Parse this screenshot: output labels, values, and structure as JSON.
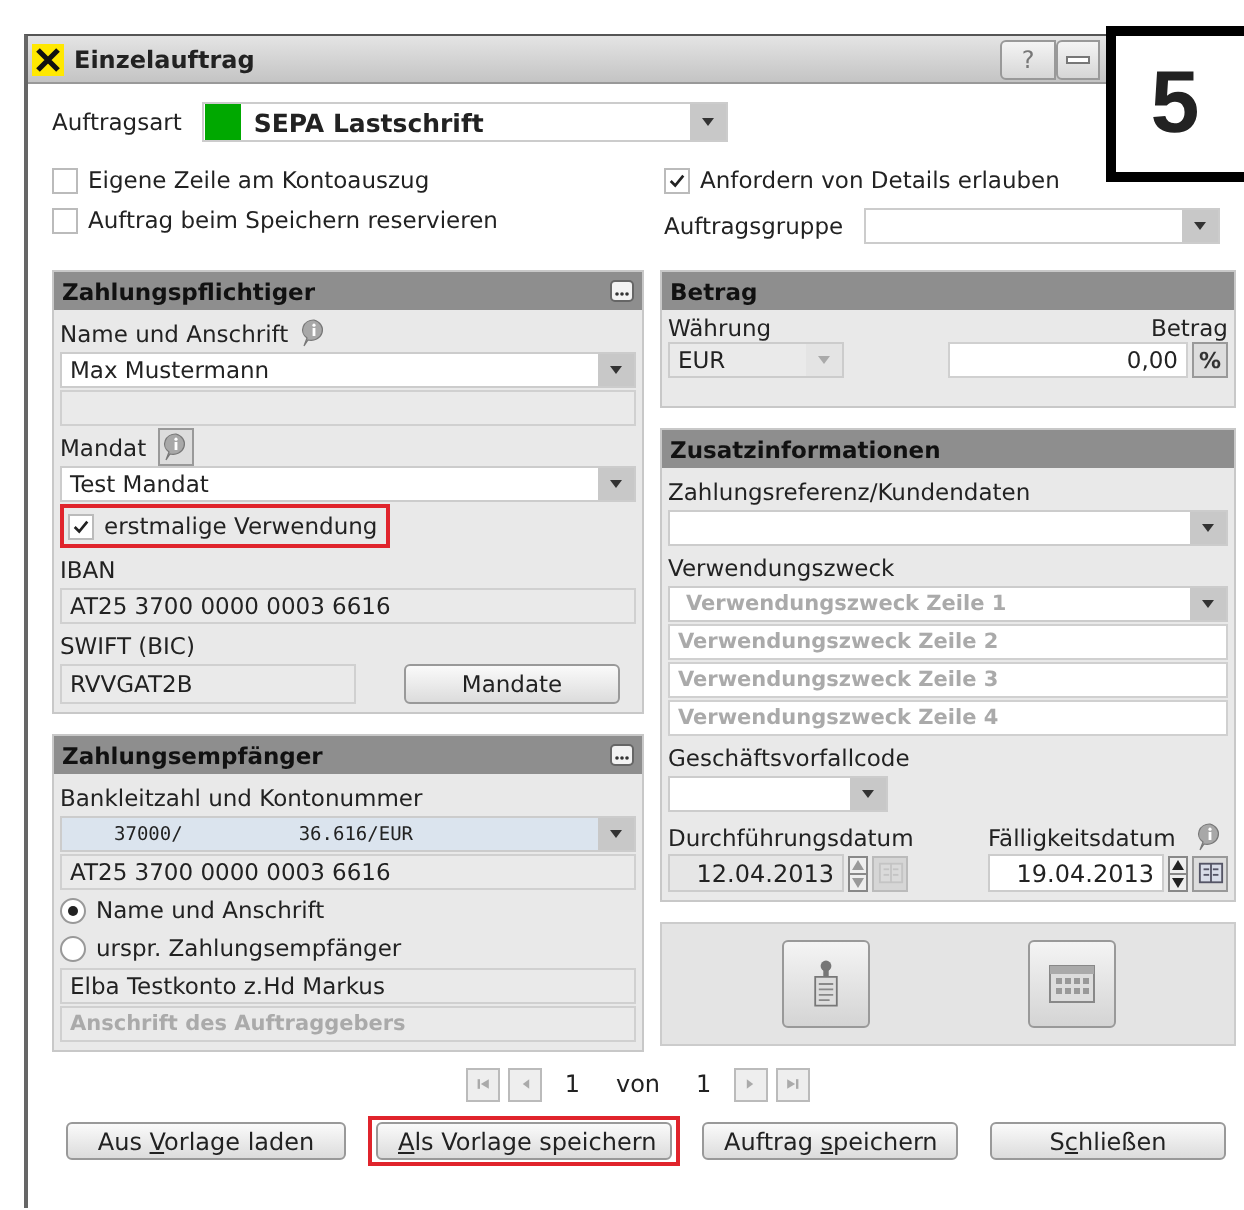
{
  "window": {
    "title": "Einzelauftrag",
    "help_button": "?"
  },
  "step_badge": "5",
  "order_type": {
    "label": "Auftragsart",
    "value": "SEPA Lastschrift"
  },
  "options_left": [
    {
      "label": "Eigene Zeile am Kontoauszug",
      "checked": false
    },
    {
      "label": "Auftrag beim Speichern reservieren",
      "checked": false
    }
  ],
  "allow_details": {
    "label": "Anfordern von Details erlauben",
    "checked": true
  },
  "order_group": {
    "label": "Auftragsgruppe"
  },
  "payer": {
    "title": "Zahlungspflichtiger",
    "items": [
      {
        "kind": "label",
        "text": "Name und Anschrift",
        "info": true
      },
      {
        "kind": "combo",
        "value": "Max Mustermann"
      },
      {
        "kind": "field",
        "readonly": true
      },
      {
        "kind": "label",
        "text": "Mandat",
        "info": true,
        "info_boxed": true
      },
      {
        "kind": "combo",
        "value": "Test Mandat"
      },
      {
        "kind": "checkbox",
        "label": "erstmalige Verwendung",
        "checked": true,
        "highlighted": true
      },
      {
        "kind": "label",
        "text": "IBAN"
      },
      {
        "kind": "field",
        "value": "AT25 3700 0000 0003 6616",
        "readonly": true
      },
      {
        "kind": "label",
        "text": "SWIFT (BIC)"
      },
      {
        "kind": "field_button",
        "value": "RVVGAT2B",
        "button": "Mandate"
      }
    ]
  },
  "payee": {
    "title": "Zahlungsempfänger",
    "items": [
      {
        "kind": "label",
        "text": "Bankleitzahl und Kontonummer"
      },
      {
        "kind": "account",
        "bank_code": "37000/",
        "account": "36.616/EUR"
      },
      {
        "kind": "field",
        "value": "AT25 3700 0000 0003 6616",
        "readonly": true
      },
      {
        "kind": "radio",
        "label": "Name und Anschrift",
        "selected": true
      },
      {
        "kind": "radio",
        "label": "urspr. Zahlungsempfänger",
        "selected": false
      },
      {
        "kind": "field",
        "value": "Elba Testkonto z.Hd Markus",
        "readonly": true
      },
      {
        "kind": "field",
        "placeholder": "Anschrift des Auftraggebers",
        "readonly": true
      }
    ]
  },
  "amount": {
    "title": "Betrag",
    "currency_label": "Währung",
    "currency": "EUR",
    "amount_label": "Betrag",
    "amount": "0,00",
    "percent_button": "%"
  },
  "additional": {
    "title": "Zusatzinformationen",
    "items": [
      {
        "kind": "label",
        "text": "Zahlungsreferenz/Kundendaten"
      },
      {
        "kind": "combo"
      },
      {
        "kind": "label",
        "text": "Verwendungszweck"
      },
      {
        "kind": "combo",
        "placeholder": "Verwendungszweck Zeile 1"
      },
      {
        "kind": "field",
        "placeholder": "Verwendungszweck Zeile 2",
        "readonly": false
      },
      {
        "kind": "field",
        "placeholder": "Verwendungszweck Zeile 3",
        "readonly": false
      },
      {
        "kind": "field",
        "placeholder": "Verwendungszweck Zeile 4",
        "readonly": false
      },
      {
        "kind": "label",
        "text": "Geschäftsvorfallcode"
      },
      {
        "kind": "small_combo"
      },
      {
        "kind": "dates",
        "dates": [
          {
            "label": "Durchführungsdatum",
            "value": "12.04.2013",
            "disabled": true
          },
          {
            "label": "Fälligkeitsdatum",
            "value": "19.04.2013",
            "disabled": false,
            "info": true
          }
        ]
      }
    ]
  },
  "pager": {
    "current": "1",
    "of": "von",
    "total": "1"
  },
  "buttons": [
    {
      "before": "Aus ",
      "mnemonic": "V",
      "after": "orlage laden",
      "highlighted": false
    },
    {
      "mnemonic": "A",
      "after": "ls Vorlage speichern",
      "highlighted": true
    },
    {
      "before": "Auftrag ",
      "mnemonic": "s",
      "after": "peichern",
      "highlighted": false
    },
    {
      "before": "S",
      "mnemonic": "c",
      "after": "hließen",
      "highlighted": false
    }
  ]
}
